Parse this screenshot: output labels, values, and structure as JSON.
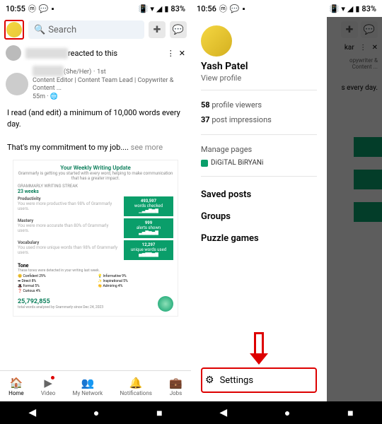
{
  "status": {
    "time1": "10:55",
    "time2": "10:56",
    "battery": "83%"
  },
  "left": {
    "search_placeholder": "Search",
    "post1_suffix": "reacted to this",
    "post2_pronoun": "(She/Her)",
    "post2_degree": "1st",
    "post2_headline": "Content Editor | Content Team Lead | Copywriter & Content ...",
    "post2_time": "55m",
    "body_line1": "I read (and edit) a minimum of 10,000 words every day.",
    "body_line2": "That's my commitment to my job....",
    "see_more": "see more",
    "report": {
      "title": "Your Weekly Writing Update",
      "streak_label": "GRAMMARLY WRITING STREAK",
      "streak_value": "23 weeks",
      "blocks": [
        {
          "label": "Productivity",
          "value": "493,597",
          "unit": "words checked"
        },
        {
          "label": "Mastery",
          "value": "999",
          "unit": "alerts shown"
        },
        {
          "label": "Vocabulary",
          "value": "12,297",
          "unit": "unique words used"
        }
      ],
      "tone_label": "Tone",
      "tones": [
        "Confident",
        "Informative",
        "Direct",
        "Inspirational",
        "Formal",
        "Admiring",
        "Curious"
      ],
      "total_num": "25,792,855",
      "total_label": "total words analyzed by Grammarly since Dec 24, 2023"
    },
    "nav": [
      {
        "icon": "🏠",
        "label": "Home"
      },
      {
        "icon": "▶",
        "label": "Video"
      },
      {
        "icon": "👥",
        "label": "My Network"
      },
      {
        "icon": "🔔",
        "label": "Notifications"
      },
      {
        "icon": "💼",
        "label": "Jobs"
      }
    ]
  },
  "drawer": {
    "name": "Yash Patel",
    "view_profile": "View profile",
    "stat1_num": "58",
    "stat1_label": "profile viewers",
    "stat2_num": "37",
    "stat2_label": "post impressions",
    "manage": "Manage pages",
    "page1": "DiGiTAL BiRYANi",
    "items": [
      "Saved posts",
      "Groups",
      "Puzzle games"
    ],
    "settings": "Settings"
  },
  "rs": {
    "name_frag": "kar",
    "headline_frag": "opywriter & Content ...",
    "body_frag": "s every day."
  }
}
